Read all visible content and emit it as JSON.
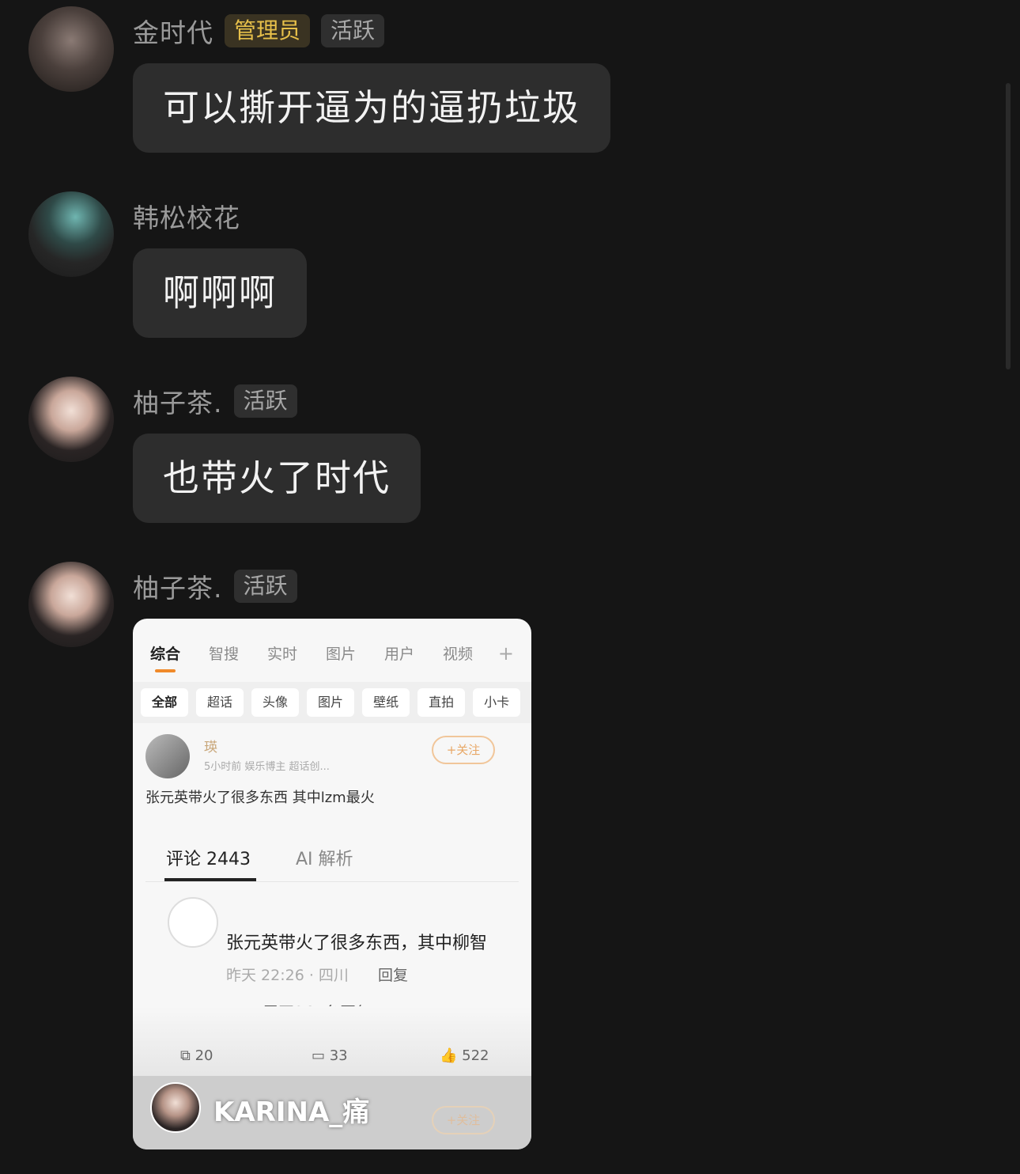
{
  "messages": [
    {
      "name": "金时代",
      "badges": [
        "管理员",
        "活跃"
      ],
      "text": "可以撕开逼为的逼扔垃圾"
    },
    {
      "name": "韩松校花",
      "badges": [],
      "text": "啊啊啊"
    },
    {
      "name": "柚子茶.",
      "badges": [
        "活跃"
      ],
      "text": "也带火了时代"
    },
    {
      "name": "柚子茶.",
      "badges": [
        "活跃"
      ]
    }
  ],
  "card": {
    "tabs": [
      "综合",
      "智搜",
      "实时",
      "图片",
      "用户",
      "视频"
    ],
    "plus": "+",
    "chips": [
      "全部",
      "超话",
      "头像",
      "图片",
      "壁纸",
      "直拍",
      "小卡"
    ],
    "post_name": "瑛",
    "post_meta": "5小时前  娱乐博主 超话创...",
    "follow": "+关注",
    "post_text": "张元英带火了很多东西 其中lzm最火",
    "comment_tab": "评论 2443",
    "ai_tab": "AI 解析",
    "comment_text": "张元英带火了很多东西，其中柳智",
    "comment_time": "昨天 22:26 · 四川",
    "reply": "回复",
    "expand": "展开264条回复 ⌄",
    "stats": [
      "20",
      "33",
      "522"
    ],
    "watermark": "KARINA_痛"
  }
}
